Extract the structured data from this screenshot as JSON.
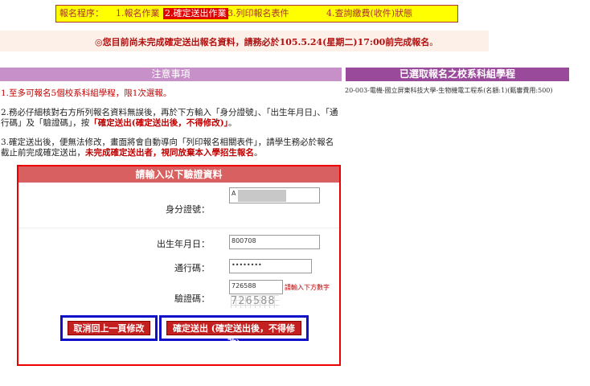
{
  "steps": {
    "prefix": "報名程序：",
    "items": [
      {
        "label": "1.報名作業",
        "active": false
      },
      {
        "label": "2.確定送出作業",
        "active": true
      },
      {
        "label": "3.列印報名表件",
        "active": false
      },
      {
        "label": "4.查詢繳費(收件)狀態",
        "active": false
      }
    ]
  },
  "notice": {
    "main": "◎您目前尚未完成確定送出報名資料，請務必於105.5.24(星期二)17:00前完成報名",
    "end": "。"
  },
  "headers": {
    "left": "注意事項",
    "right": "已選取報名之校系科組學程"
  },
  "selected_programs": [
    "20-003-電機-國立屏東科技大學-生物機電工程系(名額:1)(甄審費用:500)"
  ],
  "instructions": {
    "item1": "1.至多可報名5個校系科組學程，限1次選報。",
    "item2_a": "2.務必仔細核對右方所列報名資料無誤後，再於下方輸入「身分證號」、「出生年月日」、「通行碼」及「驗證碼」，按",
    "item2_b": "「確定送出(確定送出後，不得修改)」",
    "item2_c": "。",
    "item3_a": "3.確定送出後，便無法修改，畫面將會自動導向「列印報名相關表件」，請學生務必於報名截止前完成確定送出，",
    "item3_b": "未完成確定送出者，視同放棄本入學招生報名",
    "item3_c": "。"
  },
  "form": {
    "title": "請輸入以下驗證資料",
    "id_label": "身分證號：",
    "id_value": "A",
    "birth_label": "出生年月日：",
    "birth_value": "800708",
    "pass_label": "通行碼：",
    "pass_value": "••••••••",
    "captcha_label": "驗證碼：",
    "captcha_value": "726588",
    "captcha_hint": "請輸入下方數字",
    "captcha_image_text": "726588"
  },
  "buttons": {
    "cancel": "取消回上一頁修改",
    "submit": "確定送出 (確定送出後，不得修改)"
  },
  "colors": {
    "step_bar": "#ffff00",
    "step_active": "#e00000",
    "header_left": "#c890c8",
    "header_right": "#9a4a9a",
    "form_border": "#ee0000",
    "button_frame": "#1010c8",
    "button": "#c42020"
  }
}
